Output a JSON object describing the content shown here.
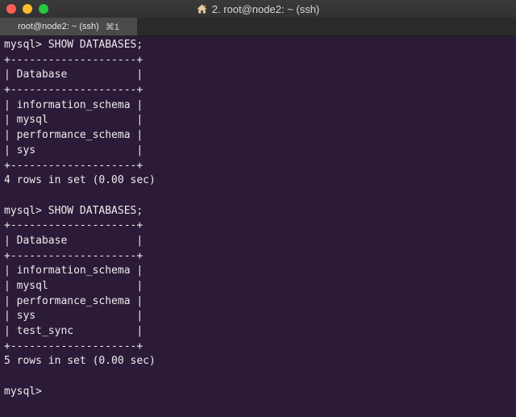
{
  "window": {
    "title": "2. root@node2: ~ (ssh)",
    "icon": "home-icon"
  },
  "tab": {
    "label": "root@node2: ~ (ssh)",
    "shortcut": "⌘1"
  },
  "colors": {
    "terminal_background": "#2b1b38",
    "terminal_text": "#ececec",
    "close": "#ff5f57",
    "minimize": "#febc2e",
    "zoom": "#28c840"
  },
  "terminal": {
    "lines": [
      "mysql> SHOW DATABASES;",
      "+--------------------+",
      "| Database           |",
      "+--------------------+",
      "| information_schema |",
      "| mysql              |",
      "| performance_schema |",
      "| sys                |",
      "+--------------------+",
      "4 rows in set (0.00 sec)",
      "",
      "mysql> SHOW DATABASES;",
      "+--------------------+",
      "| Database           |",
      "+--------------------+",
      "| information_schema |",
      "| mysql              |",
      "| performance_schema |",
      "| sys                |",
      "| test_sync          |",
      "+--------------------+",
      "5 rows in set (0.00 sec)",
      "",
      "mysql> "
    ]
  }
}
